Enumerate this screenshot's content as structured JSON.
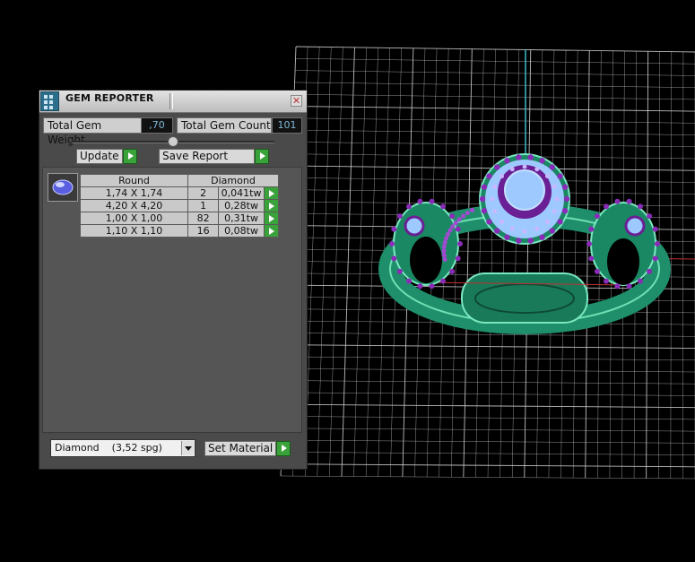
{
  "panel": {
    "title": "GEM REPORTER",
    "close_label": "✕",
    "total_weight_label": "Total Gem Weight",
    "total_weight_value": ",70",
    "total_count_label": "Total Gem Count",
    "total_count_value": "101",
    "update_label": "Update",
    "save_label": "Save Report",
    "table": {
      "col_shape": "Round",
      "col_material": "Diamond",
      "rows": [
        {
          "size": "1,74 X 1,74",
          "count": "2",
          "weight": "0,041tw"
        },
        {
          "size": "4,20 X 4,20",
          "count": "1",
          "weight": "0,28tw"
        },
        {
          "size": "1,00 X 1,00",
          "count": "82",
          "weight": "0,31tw"
        },
        {
          "size": "1,10 X 1,10",
          "count": "16",
          "weight": "0,08tw"
        }
      ]
    },
    "material_value": "Diamond    (3,52 spg)",
    "set_material_label": "Set Material"
  },
  "colors": {
    "panel_bg": "#4a4a4a",
    "grid_line": "#cfcfcf",
    "ring_metal": "#1e8f6a",
    "gem_blue": "#9ec9ff",
    "gem_purple": "#8a2bb8",
    "accent_green": "#3aa23a"
  }
}
